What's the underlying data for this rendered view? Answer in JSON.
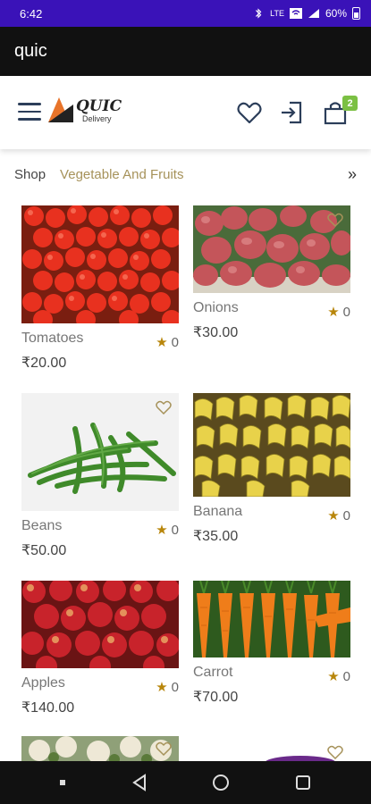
{
  "status_bar": {
    "time": "6:42",
    "network": "LTE",
    "battery": "60%"
  },
  "app_bar": {
    "title": "quic"
  },
  "header": {
    "logo_text": "QUIC",
    "logo_sub": "Delivery",
    "cart_count": "2"
  },
  "breadcrumb": {
    "shop": "Shop",
    "category": "Vegetable And Fruits",
    "more": "»"
  },
  "products": [
    {
      "name": "Tomatoes",
      "price": "₹20.00",
      "rating": "0"
    },
    {
      "name": "Onions",
      "price": "₹30.00",
      "rating": "0"
    },
    {
      "name": "Beans",
      "price": "₹50.00",
      "rating": "0"
    },
    {
      "name": "Banana",
      "price": "₹35.00",
      "rating": "0"
    },
    {
      "name": "Apples",
      "price": "₹140.00",
      "rating": "0"
    },
    {
      "name": "Carrot",
      "price": "₹70.00",
      "rating": "0"
    }
  ],
  "colors": {
    "status_bar": "#3a12b8",
    "app_bar": "#111111",
    "accent_gold": "#a6925a",
    "star": "#b8860b",
    "cart_badge": "#7bc043"
  }
}
